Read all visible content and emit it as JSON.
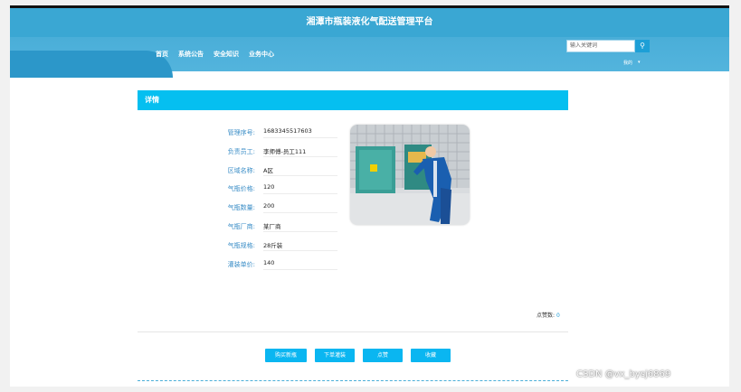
{
  "app": {
    "title": "湘潭市瓶装液化气配送管理平台"
  },
  "nav": {
    "items": [
      "首页",
      "系统公告",
      "安全知识",
      "业务中心"
    ]
  },
  "search": {
    "placeholder": "输入关键词"
  },
  "user": {
    "label": "我的"
  },
  "detail": {
    "header": "详情",
    "fields": [
      {
        "label": "管理序号:",
        "value": "1683345517603"
      },
      {
        "label": "负责员工:",
        "value": "李师傅-员工111"
      },
      {
        "label": "区域名称:",
        "value": "A区"
      },
      {
        "label": "气瓶价格:",
        "value": "120"
      },
      {
        "label": "气瓶数量:",
        "value": "200"
      },
      {
        "label": "气瓶厂商:",
        "value": "某厂商"
      },
      {
        "label": "气瓶规格:",
        "value": "28斤装"
      },
      {
        "label": "灌装单价:",
        "value": "140"
      }
    ],
    "likes_label": "点赞数:",
    "likes_value": "0"
  },
  "actions": [
    "购买新瓶",
    "下单灌装",
    "点赞",
    "收藏"
  ],
  "watermark": "CSDN @vx_bysj6869",
  "colors": {
    "primary": "#3aa7d3",
    "header": "#05bff0",
    "button": "#0ab6f1"
  }
}
